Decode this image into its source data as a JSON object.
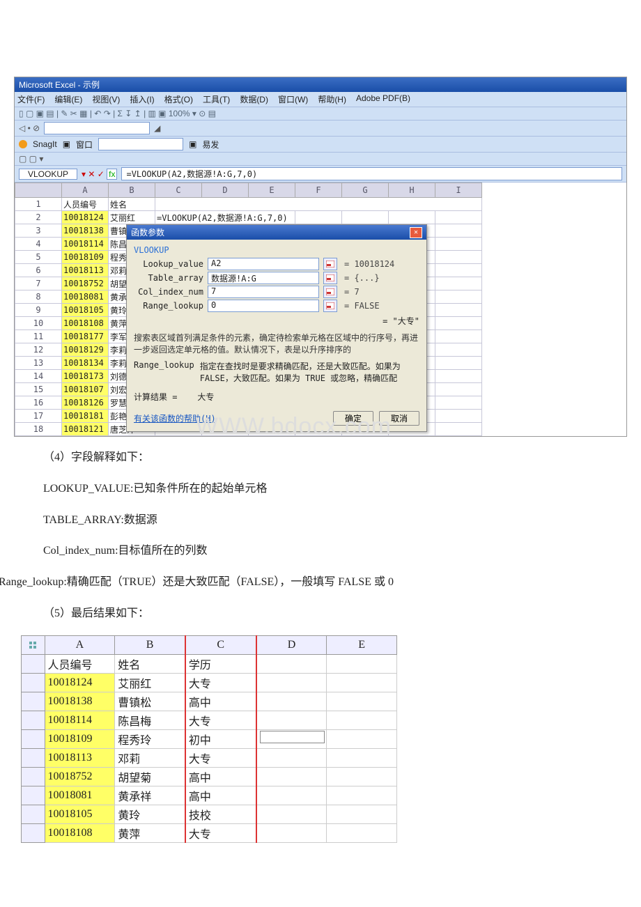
{
  "window": {
    "title": "Microsoft Excel - 示例"
  },
  "menu": {
    "file": "文件(F)",
    "edit": "编辑(E)",
    "view": "视图(V)",
    "insert": "插入(I)",
    "format": "格式(O)",
    "tools": "工具(T)",
    "data": "数据(D)",
    "window": "窗口(W)",
    "help": "帮助(H)",
    "adobe": "Adobe PDF(B)"
  },
  "toolbar": {
    "zoom": "100%",
    "snagit": "SnagIt",
    "snagitWin": "窗口",
    "yifa": "易发"
  },
  "formula": {
    "nameBox": "VLOOKUP",
    "fx": "fx",
    "content": "=VLOOKUP(A2,数据源!A:G,7,0)"
  },
  "columns": [
    "A",
    "B",
    "C",
    "D",
    "E",
    "F",
    "G",
    "H",
    "I"
  ],
  "sheetHeader": {
    "a": "人员编号",
    "b": "姓名"
  },
  "c2": "=VLOOKUP(A2,数据源!A:G,7,0)",
  "rows": [
    {
      "n": "2",
      "id": "10018124",
      "name": "艾丽红"
    },
    {
      "n": "3",
      "id": "10018138",
      "name": "曹镇松"
    },
    {
      "n": "4",
      "id": "10018114",
      "name": "陈昌梅"
    },
    {
      "n": "5",
      "id": "10018109",
      "name": "程秀玲"
    },
    {
      "n": "6",
      "id": "10018113",
      "name": "邓莉"
    },
    {
      "n": "7",
      "id": "10018752",
      "name": "胡望菊"
    },
    {
      "n": "8",
      "id": "10018081",
      "name": "黄承祥"
    },
    {
      "n": "9",
      "id": "10018105",
      "name": "黄玲"
    },
    {
      "n": "10",
      "id": "10018108",
      "name": "黄萍"
    },
    {
      "n": "11",
      "id": "10018177",
      "name": "李军"
    },
    {
      "n": "12",
      "id": "10018129",
      "name": "李莉"
    },
    {
      "n": "13",
      "id": "10018134",
      "name": "李莉"
    },
    {
      "n": "14",
      "id": "10018173",
      "name": "刘德志"
    },
    {
      "n": "15",
      "id": "10018107",
      "name": "刘宏胜"
    },
    {
      "n": "16",
      "id": "10018126",
      "name": "罗慧明"
    },
    {
      "n": "17",
      "id": "10018181",
      "name": "彭艳霞"
    },
    {
      "n": "18",
      "id": "10018121",
      "name": "唐芝萍"
    }
  ],
  "dialog": {
    "title": "函数参数",
    "fname": "VLOOKUP",
    "args": {
      "lookup_value": {
        "label": "Lookup_value",
        "val": "A2",
        "eq": "= 10018124"
      },
      "table_array": {
        "label": "Table_array",
        "val": "数据源!A:G",
        "eq": "= {...}"
      },
      "col_index_num": {
        "label": "Col_index_num",
        "val": "7",
        "eq": "= 7"
      },
      "range_lookup": {
        "label": "Range_lookup",
        "val": "0",
        "eq": "= FALSE"
      }
    },
    "preview": "= \"大专\"",
    "desc": "搜索表区域首列满足条件的元素，确定待检索单元格在区域中的行序号，再进一步返回选定单元格的值。默认情况下，表是以升序排序的",
    "rlLabel": "Range_lookup",
    "rlDesc": "指定在查找时是要求精确匹配，还是大致匹配。如果为 FALSE，大致匹配。如果为 TRUE 或忽略，精确匹配",
    "resultLabel": "计算结果 =",
    "resultVal": "大专",
    "helpLink": "有关该函数的帮助(H)",
    "ok": "确定",
    "cancel": "取消"
  },
  "watermark": "WWW.bdocx.com",
  "explain": {
    "h": "（4）字段解释如下：",
    "l1": "LOOKUP_VALUE:已知条件所在的起始单元格",
    "l2": "TABLE_ARRAY:数据源",
    "l3": "Col_index_num:目标值所在的列数",
    "l4": "Range_lookup:精确匹配（TRUE）还是大致匹配（FALSE），一般填写 FALSE 或 0",
    "h2": "（5）最后结果如下："
  },
  "result": {
    "cols": [
      "A",
      "B",
      "C",
      "D",
      "E"
    ],
    "header": {
      "a": "人员编号",
      "b": "姓名",
      "c": "学历"
    },
    "rows": [
      {
        "id": "10018124",
        "name": "艾丽红",
        "edu": "大专"
      },
      {
        "id": "10018138",
        "name": "曹镇松",
        "edu": "高中"
      },
      {
        "id": "10018114",
        "name": "陈昌梅",
        "edu": "大专"
      },
      {
        "id": "10018109",
        "name": "程秀玲",
        "edu": "初中"
      },
      {
        "id": "10018113",
        "name": "邓莉",
        "edu": "大专"
      },
      {
        "id": "10018752",
        "name": "胡望菊",
        "edu": "高中"
      },
      {
        "id": "10018081",
        "name": "黄承祥",
        "edu": "高中"
      },
      {
        "id": "10018105",
        "name": "黄玲",
        "edu": "技校"
      },
      {
        "id": "10018108",
        "name": "黄萍",
        "edu": "大专"
      }
    ]
  }
}
